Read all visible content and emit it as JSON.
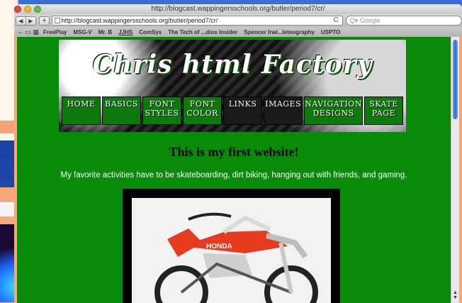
{
  "window": {
    "title": "http://blogcast.wappingersschools.org/butler/period7/cr/"
  },
  "toolbar": {
    "back": "◀",
    "forward": "▶",
    "add": "+",
    "url": "http://blogcast.wappingersschools.org/butler/period7/cr/",
    "reload": "C",
    "search_placeholder": "Q▾ Google"
  },
  "bookmarks": [
    {
      "label": "FreePlay",
      "underline": false
    },
    {
      "label": "MSG-V",
      "underline": false
    },
    {
      "label": "Mr. B",
      "underline": false
    },
    {
      "label": "JJHS",
      "underline": true
    },
    {
      "label": "ComSys",
      "underline": false
    },
    {
      "label": "The Tech of ...dios Insider",
      "underline": false
    },
    {
      "label": "Spencer Irwi...leteography",
      "underline": false
    },
    {
      "label": "USPTO",
      "underline": false
    }
  ],
  "banner": {
    "title": "Chris html Factory",
    "nav": [
      {
        "line1": "HOME",
        "line2": ""
      },
      {
        "line1": "BASICS",
        "line2": ""
      },
      {
        "line1": "FONT",
        "line2": "STYLES"
      },
      {
        "line1": "FONT",
        "line2": "COLOR"
      },
      {
        "line1": "LINKS",
        "line2": ""
      },
      {
        "line1": "IMAGES",
        "line2": ""
      },
      {
        "line1": "NAVIGATION",
        "line2": "DESIGNS"
      },
      {
        "line1": "SKATE",
        "line2": "PAGE"
      }
    ]
  },
  "content": {
    "heading": "This is my first website!",
    "text": "My favorite activities have to be skateboarding, dirt biking, hanging out with friends, and gaming.",
    "photo_label": "HONDA"
  },
  "colors": {
    "page_bg": "#0a8a0a",
    "frame": "#f7a778",
    "nav_item": "#0b7a0b"
  }
}
